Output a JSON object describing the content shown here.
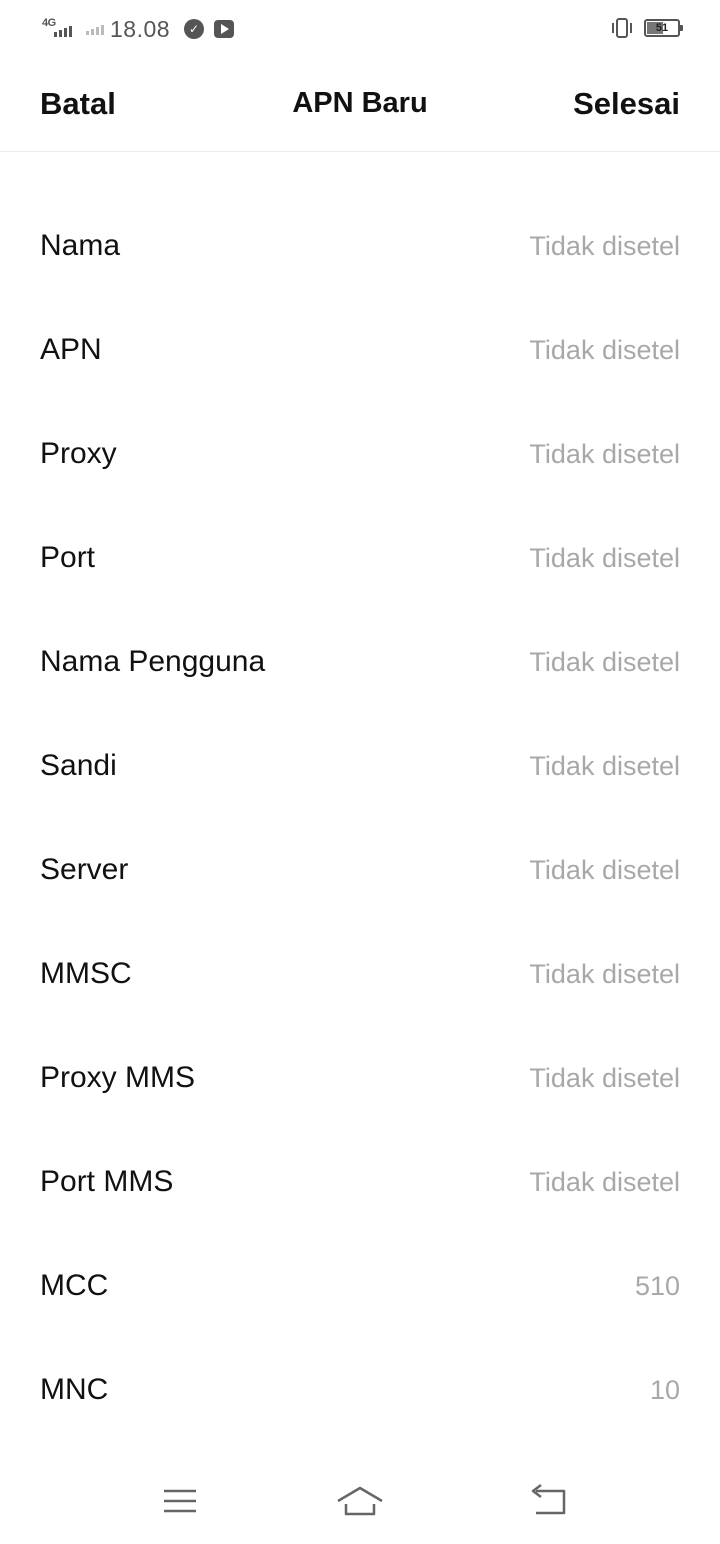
{
  "status_bar": {
    "network_type": "4G",
    "time": "18.08",
    "battery_level": "51",
    "icons": [
      "signal-icon",
      "signal-secondary-icon",
      "activity-icon",
      "youtube-icon",
      "vibrate-icon",
      "battery-icon"
    ]
  },
  "header": {
    "cancel_label": "Batal",
    "title": "APN Baru",
    "done_label": "Selesai"
  },
  "fields": [
    {
      "label": "Nama",
      "value": "Tidak disetel"
    },
    {
      "label": "APN",
      "value": "Tidak disetel"
    },
    {
      "label": "Proxy",
      "value": "Tidak disetel"
    },
    {
      "label": "Port",
      "value": "Tidak disetel"
    },
    {
      "label": "Nama Pengguna",
      "value": "Tidak disetel"
    },
    {
      "label": "Sandi",
      "value": "Tidak disetel"
    },
    {
      "label": "Server",
      "value": "Tidak disetel"
    },
    {
      "label": "MMSC",
      "value": "Tidak disetel"
    },
    {
      "label": "Proxy MMS",
      "value": "Tidak disetel"
    },
    {
      "label": "Port MMS",
      "value": "Tidak disetel"
    },
    {
      "label": "MCC",
      "value": "510"
    },
    {
      "label": "MNC",
      "value": "10"
    }
  ],
  "nav_bar": {
    "icons": [
      "menu-icon",
      "home-icon",
      "back-icon"
    ]
  },
  "colors": {
    "text_primary": "#111111",
    "text_placeholder": "#a8a8a8",
    "status_icons": "#555555",
    "divider": "#ececec"
  }
}
